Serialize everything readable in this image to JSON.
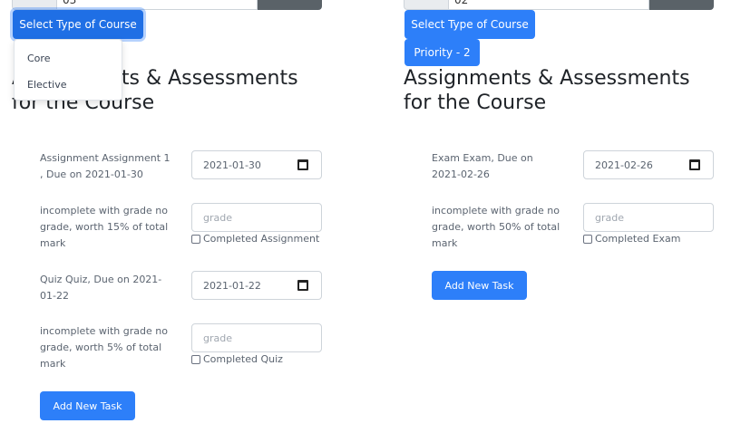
{
  "left": {
    "top_input_value": "03",
    "select_button": "Select Type of Course",
    "dropdown_items": [
      "Core",
      "Elective"
    ],
    "heading_line1": "Assignments & Assessments",
    "heading_line2": "for the Course",
    "tasks": [
      {
        "title": "Assignment Assignment 1 , Due on 2021-01-30",
        "date": "2021-01-30",
        "status": "incomplete with grade no grade, worth 15% of total mark",
        "grade_placeholder": "grade",
        "completed_label": "Completed Assignment"
      },
      {
        "title": "Quiz Quiz, Due on 2021-01-22",
        "date": "2021-01-22",
        "status": "incomplete with grade no grade, worth 5% of total mark",
        "grade_placeholder": "grade",
        "completed_label": "Completed Quiz"
      }
    ],
    "add_button": "Add New Task"
  },
  "right": {
    "top_input_value": "02",
    "select_button": "Select Type of Course",
    "priority_button": "Priority - 2",
    "heading_line1": "Assignments & Assessments",
    "heading_line2": "for the Course",
    "tasks": [
      {
        "title": "Exam Exam, Due on 2021-02-26",
        "date": "2021-02-26",
        "status": "incomplete with grade no grade, worth 50% of total mark",
        "grade_placeholder": "grade",
        "completed_label": "Completed Exam"
      }
    ],
    "add_button": "Add New Task"
  },
  "colors": {
    "primary": "#2d7ff9",
    "secondary": "#5a6268"
  }
}
